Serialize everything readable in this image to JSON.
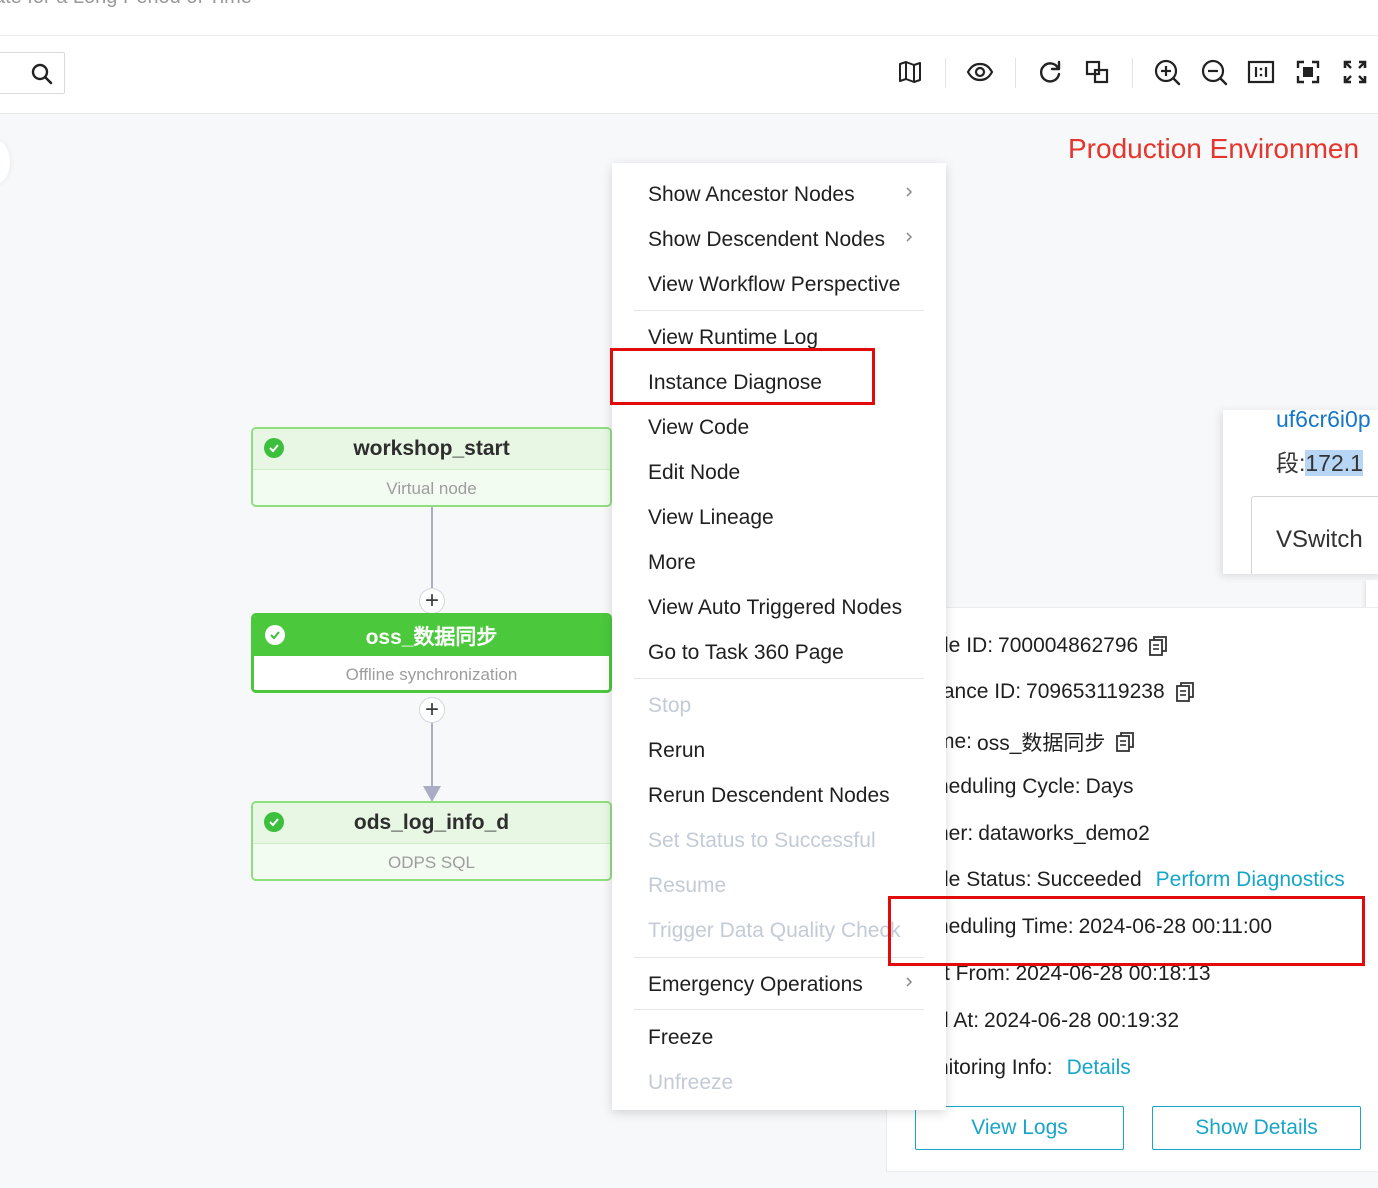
{
  "header": {
    "cut_title": "ate for a Long Period of Time"
  },
  "environment_label": "Production Environmen",
  "nodes": [
    {
      "name": "workshop_start",
      "type": "Virtual node"
    },
    {
      "name": "oss_数据同步",
      "type": "Offline synchronization"
    },
    {
      "name": "ods_log_info_d",
      "type": "ODPS SQL"
    }
  ],
  "context_menu": {
    "show_ancestor_nodes": "Show Ancestor Nodes",
    "show_descendent_nodes": "Show Descendent Nodes",
    "view_workflow_perspective": "View Workflow Perspective",
    "view_runtime_log": "View Runtime Log",
    "instance_diagnose": "Instance Diagnose",
    "view_code": "View Code",
    "edit_node": "Edit Node",
    "view_lineage": "View Lineage",
    "more": "More",
    "view_auto_triggered_nodes": "View Auto Triggered Nodes",
    "go_to_task_360_page": "Go to Task 360 Page",
    "stop": "Stop",
    "rerun": "Rerun",
    "rerun_descendent_nodes": "Rerun Descendent Nodes",
    "set_status_to_successful": "Set Status to Successful",
    "resume": "Resume",
    "trigger_data_quality_check": "Trigger Data Quality Check",
    "emergency_operations": "Emergency Operations",
    "freeze": "Freeze",
    "unfreeze": "Unfreeze"
  },
  "vswitch_card": {
    "id_text": "uf6cr6i0p",
    "segment_label": "段:",
    "segment_value": "172.1",
    "vswitch_text": "VSwitch"
  },
  "info_panel": {
    "node_id_label": "de ID:",
    "node_id_value": "700004862796",
    "instance_id_label": "tance ID:",
    "instance_id_value": "709653119238",
    "name_label": "me:",
    "name_value": "oss_数据同步",
    "cycle_label": "heduling Cycle:",
    "cycle_value": "Days",
    "owner_label": "ner:",
    "owner_value": "dataworks_demo2",
    "status_label": "de Status:",
    "status_value": "Succeeded",
    "status_link": "Perform Diagnostics",
    "sched_time_label": "heduling Time:",
    "sched_time_value": "2024-06-28 00:11:00",
    "start_label": "rt From:",
    "start_value": "2024-06-28 00:18:13",
    "end_label": "d At:",
    "end_value": "2024-06-28 00:19:32",
    "monitor_label": "nitoring Info:",
    "monitor_link": "Details",
    "view_logs": "View Logs",
    "show_details": "Show Details"
  }
}
